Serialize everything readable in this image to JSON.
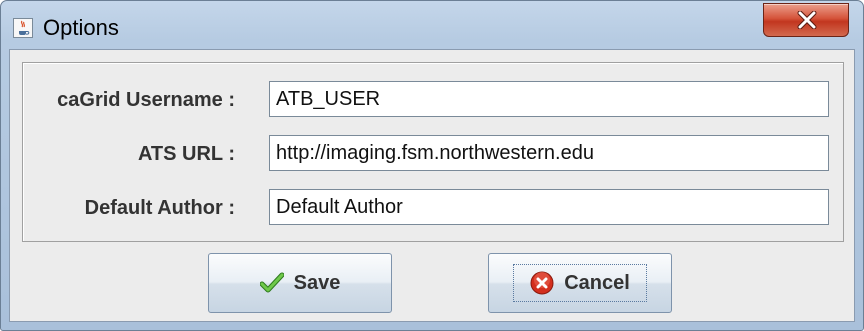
{
  "window": {
    "title": "Options",
    "close_icon": "close-icon",
    "app_icon": "java-coffee-icon"
  },
  "form": {
    "fields": [
      {
        "label": "caGrid Username :",
        "value": "ATB_USER"
      },
      {
        "label": "ATS URL :",
        "value": "http://imaging.fsm.northwestern.edu"
      },
      {
        "label": "Default Author :",
        "value": "Default Author"
      }
    ]
  },
  "buttons": {
    "save_label": "Save",
    "save_icon": "checkmark-icon",
    "cancel_label": "Cancel",
    "cancel_icon": "cancel-x-icon"
  },
  "colors": {
    "close_button": "#c2361f",
    "save_check": "#4cae32",
    "cancel_circle": "#d32f1e"
  }
}
